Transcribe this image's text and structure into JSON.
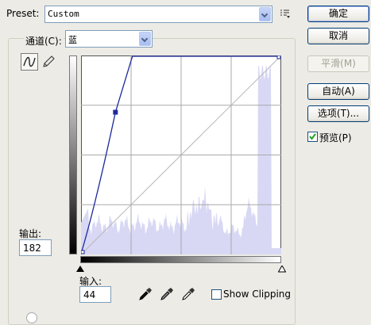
{
  "preset": {
    "label": "Preset:",
    "value": "Custom"
  },
  "channel": {
    "label": "通道(C):",
    "value": "蓝"
  },
  "buttons": {
    "ok": "确定",
    "cancel": "取消",
    "smooth": "平滑(M)",
    "auto": "自动(A)",
    "options": "选项(T)..."
  },
  "preview": {
    "label": "预览(P)",
    "checked": true
  },
  "output": {
    "label": "输出:",
    "value": "182"
  },
  "input": {
    "label": "输入:",
    "value": "44"
  },
  "show_clipping": {
    "label": "Show Clipping",
    "checked": false
  },
  "colors": {
    "curve": "#1f2a9c",
    "histogram": "#d8d8f5",
    "accent": "#003c74"
  },
  "curve": {
    "domain": [
      0,
      255
    ],
    "points": [
      [
        0,
        0
      ],
      [
        44,
        182
      ],
      [
        255,
        255
      ]
    ]
  },
  "icons": [
    "curve-tool-icon",
    "pencil-icon",
    "preset-menu-icon",
    "black-eyedropper-icon",
    "gray-eyedropper-icon",
    "white-eyedropper-icon"
  ]
}
